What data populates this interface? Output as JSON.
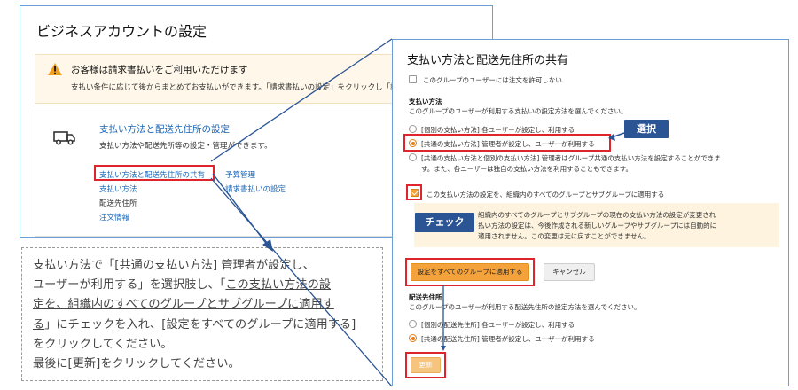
{
  "business_settings": {
    "title": "ビジネスアカウントの設定",
    "alert": {
      "title": "お客様は請求書払いをご利用いただけます",
      "body": "支払い条件に応じて後からまとめてお支払いができます。「請求書払いの設定」をクリックし「請"
    },
    "card": {
      "title": "支払い方法と配送先住所の設定",
      "description": "支払い方法や配送先所等の設定・管理ができます。",
      "links": {
        "share": "支払い方法と配送先住所の共有",
        "payment_method": "支払い方法",
        "shipping_address": "配送先住所",
        "order_info": "注文情報",
        "budget": "予算管理",
        "invoice_setup": "請求書払いの設定"
      }
    }
  },
  "dialog": {
    "title": "支払い方法と配送先住所の共有",
    "disallow_orders_label": "このグループのユーザーには注文を許可しない",
    "payment_section": {
      "heading": "支払い方法",
      "description": "このグループのユーザーが利用する支払いの設定方法を選んでください。",
      "options": [
        "[個別の支払い方法] 各ユーザーが設定し、利用する",
        "[共通の支払い方法] 管理者が設定し、ユーザーが利用する",
        "[共通の支払い方法と個別の支払い方法] 管理者はグループ共通の支払い方法を設定することができま",
        "す。また、各ユーザーは独自の支払い方法を利用することもできます。"
      ]
    },
    "apply_all_label": "この支払い方法の設定を、組織内のすべてのグループとサブグループに適用する",
    "note_lines": [
      "組織内のすべてのグループとサブグループの現在の支払い方法の設定が変更され",
      "払い方法の設定は、今後作成される新しいグループやサブグループには自動的に",
      "適用されません。この変更は元に戻すことができません。"
    ],
    "apply_button": "設定をすべてのグループに適用する",
    "cancel_button": "キャンセル",
    "shipping_section": {
      "heading": "配送先住所",
      "description": "このグループのユーザーが利用する配送先住所の設定方法を選んでください。",
      "options": [
        "[個別の配送先住所] 各ユーザーが設定し、利用する",
        "[共通の配送先住所] 管理者が設定し、ユーザーが利用する"
      ]
    },
    "update_button": "更新"
  },
  "callouts": {
    "select": "選択",
    "check": "チェック"
  },
  "instruction": {
    "line1": "支払い方法で「[共通の支払い方法] 管理者が設定し、",
    "line2": "ユーザーが利用する」を選択肢し、「",
    "line2_u": "この支払い方法の設",
    "line3_u": "定を、組織内のすべてのグループとサブグループに適用す",
    "line4_u": "る",
    "line4_rest": "」にチェックを入れ、[設定をすべてのグループに適用する]",
    "line5": "をクリックしてください。",
    "line6": "最後に[更新]をクリックしてください。"
  },
  "colors": {
    "accent_orange": "#f4a33c",
    "highlight_red": "#e0242b",
    "callout_blue": "#2a5494",
    "link_blue": "#1766b8",
    "panel_border": "#6c9fd6"
  }
}
